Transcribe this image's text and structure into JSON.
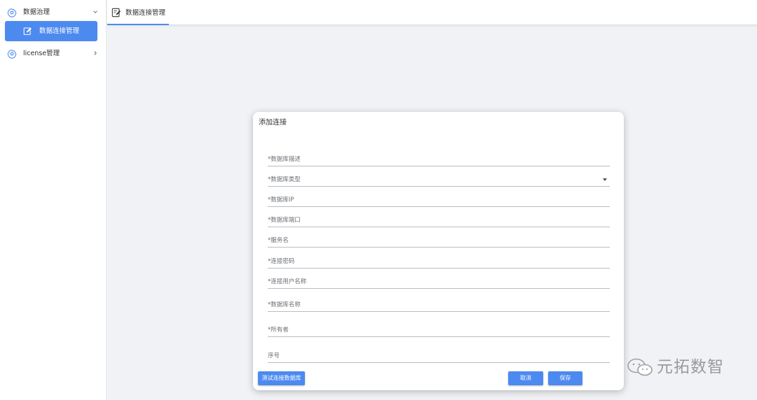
{
  "sidebar": {
    "groups": [
      {
        "label": "数据治理",
        "icon": "gear-icon",
        "expanded": true
      },
      {
        "label": "license管理",
        "icon": "gear-icon",
        "expanded": false
      }
    ],
    "active_item": {
      "label": "数据连接管理",
      "icon": "edit-icon"
    }
  },
  "tabs": [
    {
      "label": "数据连接管理",
      "icon": "edit-document-icon",
      "active": true
    }
  ],
  "dialog": {
    "title": "添加连接",
    "fields": [
      {
        "placeholder": "*数据库描述"
      },
      {
        "placeholder": "*数据库类型",
        "type": "select"
      },
      {
        "placeholder": "*数据库IP"
      },
      {
        "placeholder": "*数据库端口"
      },
      {
        "placeholder": "*服务名"
      },
      {
        "placeholder": "*连接密码"
      },
      {
        "placeholder": "*连接用户名称"
      },
      {
        "placeholder": "*数据库名称"
      },
      {
        "placeholder": "*所有者"
      },
      {
        "placeholder": "序号"
      }
    ],
    "buttons": {
      "test": "测试连接数据库",
      "cancel": "取消",
      "save": "保存"
    }
  },
  "watermark": {
    "text": "元拓数智",
    "icon": "wechat-icon"
  },
  "colors": {
    "accent": "#4d8af0",
    "background": "#f0f2f5"
  }
}
